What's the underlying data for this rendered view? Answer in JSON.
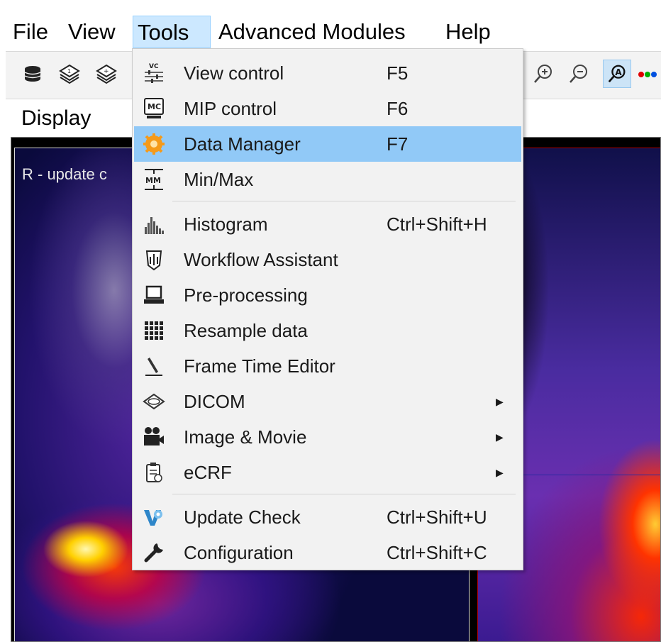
{
  "menubar": {
    "items": [
      {
        "label": "File"
      },
      {
        "label": "View"
      },
      {
        "label": "Tools"
      },
      {
        "label": "Advanced Modules"
      },
      {
        "label": "Help"
      }
    ],
    "active": "Tools"
  },
  "toolbar": {
    "icons": [
      "database-icon",
      "layers-1-icon",
      "layers-plus-icon",
      "zoom-in-icon",
      "zoom-out-icon",
      "auto-zoom-icon",
      "color-dots-icon"
    ]
  },
  "display": {
    "panel_label": "Display",
    "overlay_text": "R - update c"
  },
  "tools_menu": {
    "items": [
      {
        "label": "View control",
        "shortcut": "F5",
        "icon": "view-control-icon",
        "highlight": false
      },
      {
        "label": "MIP control",
        "shortcut": "F6",
        "icon": "mip-control-icon",
        "highlight": false
      },
      {
        "label": "Data Manager",
        "shortcut": "F7",
        "icon": "data-manager-icon",
        "highlight": true
      },
      {
        "label": "Min/Max",
        "shortcut": "",
        "icon": "min-max-icon",
        "highlight": false
      },
      {
        "label": "Histogram",
        "shortcut": "Ctrl+Shift+H",
        "icon": "histogram-icon",
        "highlight": false
      },
      {
        "label": "Workflow Assistant",
        "shortcut": "",
        "icon": "workflow-assistant-icon",
        "highlight": false
      },
      {
        "label": "Pre-processing",
        "shortcut": "",
        "icon": "pre-processing-icon",
        "highlight": false
      },
      {
        "label": "Resample data",
        "shortcut": "",
        "icon": "resample-data-icon",
        "highlight": false
      },
      {
        "label": "Frame Time Editor",
        "shortcut": "",
        "icon": "frame-time-editor-icon",
        "highlight": false
      },
      {
        "label": "DICOM",
        "shortcut": "",
        "icon": "dicom-icon",
        "submenu": true
      },
      {
        "label": "Image & Movie",
        "shortcut": "",
        "icon": "image-movie-icon",
        "submenu": true
      },
      {
        "label": "eCRF",
        "shortcut": "",
        "icon": "ecrf-icon",
        "submenu": true
      },
      {
        "label": "Update Check",
        "shortcut": "Ctrl+Shift+U",
        "icon": "update-check-icon",
        "highlight": false
      },
      {
        "label": "Configuration",
        "shortcut": "Ctrl+Shift+C",
        "icon": "configuration-icon",
        "highlight": false
      }
    ]
  },
  "colors": {
    "menu_highlight": "#91c9f7",
    "menubar_active": "#cce8ff",
    "menu_background": "#f2f2f2"
  }
}
